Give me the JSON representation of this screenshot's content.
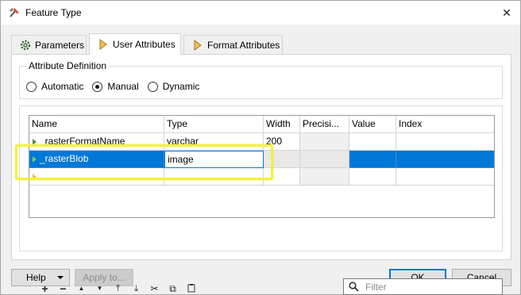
{
  "window": {
    "title": "Feature Type",
    "close": "✕"
  },
  "tabs": [
    {
      "label": "Parameters",
      "icon": "gear-icon",
      "active": false
    },
    {
      "label": "User Attributes",
      "icon": "attribute-arrow-icon",
      "active": true
    },
    {
      "label": "Format Attributes",
      "icon": "attribute-arrow-icon",
      "active": false
    }
  ],
  "attribute_definition": {
    "title": "Attribute Definition",
    "options": [
      {
        "label": "Automatic",
        "checked": false
      },
      {
        "label": "Manual",
        "checked": true
      },
      {
        "label": "Dynamic",
        "checked": false
      }
    ]
  },
  "table": {
    "columns": [
      "Name",
      "Type",
      "Width",
      "Precisi...",
      "Value",
      "Index"
    ],
    "rows": [
      {
        "name": "_rasterFormatName",
        "type": "varchar",
        "width": "200",
        "precision": "",
        "value": "",
        "index": ""
      },
      {
        "name": "_rasterBlob",
        "type": "image",
        "width": "",
        "precision": "",
        "value": "",
        "index": "",
        "selected": true
      }
    ]
  },
  "toolbar": {
    "buttons": [
      {
        "name": "add-icon",
        "glyph": "+"
      },
      {
        "name": "remove-icon",
        "glyph": "−"
      },
      {
        "name": "move-up-icon",
        "glyph": "▲"
      },
      {
        "name": "move-down-icon",
        "glyph": "▼"
      },
      {
        "name": "move-top-icon",
        "glyph": "⤒"
      },
      {
        "name": "move-bottom-icon",
        "glyph": "⤓"
      },
      {
        "name": "cut-icon",
        "glyph": "✂"
      },
      {
        "name": "copy-icon",
        "glyph": "⧉"
      },
      {
        "name": "paste-icon",
        "glyph": "📋"
      }
    ],
    "filter_placeholder": "Filter"
  },
  "buttons": {
    "help": "Help",
    "apply": "Apply to...",
    "ok": "OK",
    "cancel": "Cancel"
  },
  "colors": {
    "selection": "#0078d7",
    "highlight": "#f2f23a"
  }
}
